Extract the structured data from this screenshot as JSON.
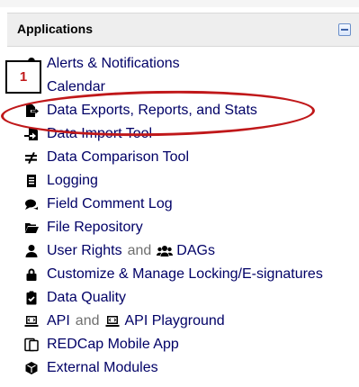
{
  "header": {
    "title": "Applications",
    "collapse_icon": "minus-icon"
  },
  "items": [
    {
      "label": "Alerts & Notifications",
      "icon": "bell-icon"
    },
    {
      "label": "Calendar",
      "icon": "calendar-icon"
    },
    {
      "label": "Data Exports, Reports, and Stats",
      "icon": "file-export-icon"
    },
    {
      "label": "Data Import Tool",
      "icon": "file-import-icon"
    },
    {
      "label": "Data Comparison Tool",
      "icon": "not-equal-icon"
    },
    {
      "label": "Logging",
      "icon": "list-icon"
    },
    {
      "label": "Field Comment Log",
      "icon": "comments-icon"
    },
    {
      "label": "File Repository",
      "icon": "folder-open-icon"
    },
    {
      "label": "User Rights",
      "icon": "user-icon",
      "connector": "and",
      "label2": "DAGs",
      "icon2": "users-icon"
    },
    {
      "label": "Customize & Manage Locking/E-signatures",
      "icon": "lock-icon"
    },
    {
      "label": "Data Quality",
      "icon": "clipboard-check-icon"
    },
    {
      "label": "API",
      "icon": "laptop-code-icon",
      "connector": "and",
      "label2": "API Playground",
      "icon2": "laptop-code-icon"
    },
    {
      "label": "REDCap Mobile App",
      "icon": "tablet-icon"
    },
    {
      "label": "External Modules",
      "icon": "cube-icon"
    }
  ],
  "annotation": {
    "number": "1",
    "color": "#c0181a"
  },
  "colors": {
    "link": "#000066",
    "header_bg": "#eeeeee",
    "connector": "#6f6f6f"
  }
}
